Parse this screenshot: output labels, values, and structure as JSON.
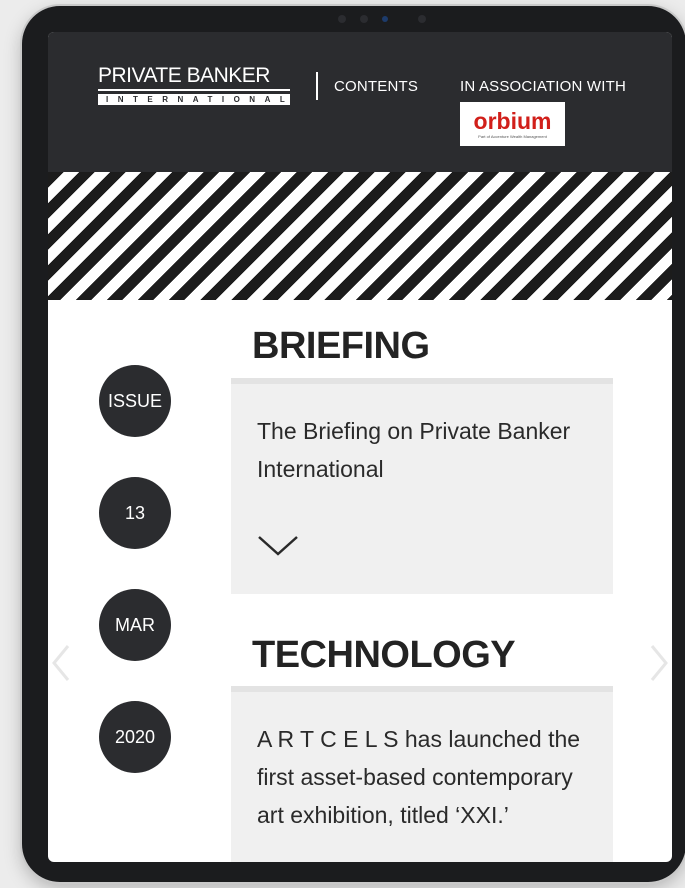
{
  "header": {
    "logo": {
      "main": "PRIVATE BANKER",
      "sub": "INTERNATIONAL"
    },
    "nav_contents": "CONTENTS",
    "association_label": "IN ASSOCIATION WITH",
    "sponsor": {
      "name": "orbium",
      "tagline": "Part of Accenture Wealth Management",
      "color": "#d11f1a"
    }
  },
  "issue_badges": [
    {
      "text": "ISSUE"
    },
    {
      "text": "13"
    },
    {
      "text": "MAR"
    },
    {
      "text": "2020"
    }
  ],
  "sections": [
    {
      "title": "BRIEFING",
      "body": "The Briefing on Private Banker International",
      "expand_icon": "chevron-down-icon"
    },
    {
      "title": "TECHNOLOGY",
      "body": "A R T C E L S has launched the first asset-based contemporary art exhibition, titled ‘XXI.’"
    }
  ],
  "colors": {
    "header_bg": "#2b2c2f",
    "card_bg": "#f0f0f0",
    "badge_bg": "#2b2c2f"
  }
}
